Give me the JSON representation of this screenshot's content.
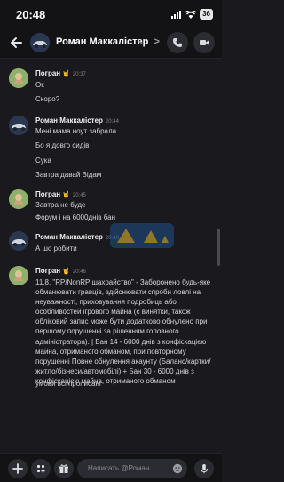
{
  "status_bar": {
    "time": "20:48",
    "battery": "36"
  },
  "header": {
    "title": "Роман Маккалістер",
    "chevron": ">"
  },
  "messages": [
    {
      "user": "Погран",
      "badge": "🤘",
      "time": "20:37",
      "lines": [
        "Ок",
        "Скоро?"
      ]
    },
    {
      "user": "Роман Маккалістер",
      "time": "20:44",
      "lines": [
        "Мені мама ноут забрала",
        "Бо я довго сидів",
        "Сука",
        "Завтра давай Відам"
      ]
    },
    {
      "user": "Погран",
      "badge": "🤘",
      "time": "20:45",
      "lines": [
        "Завтра не буде",
        "Форум і на 6000днів бан"
      ]
    },
    {
      "user": "Роман Маккалістер",
      "time": "20:46",
      "lines": [
        "А шо робити"
      ]
    },
    {
      "user": "Погран",
      "badge": "🤘",
      "time": "20:46",
      "paragraph": "11.8. \"RP/NonRP шахрайство\" - Заборонено будь-яке обманювати гравців, здійснювати спроби ловлі на неуважності, приховування подробиць або особливостей ігрового майна (є винятки, також обліковий запис може бути додатково обнулено при першому порушенні за рішенням головного адміністратора). | Бан 14 - 6000 днів з конфіскацією майна, отриманого обманом, при повторному порушенні Повне обнулення акаунту (Баланс/картки/житло/бізнеси/автомобілі) + Бан 30 - 6000 днів з конфіскацією майна, отриманого обманом",
      "lines": [
        "умови всі прописані"
      ]
    }
  ],
  "composer": {
    "placeholder": "Написать @Роман..."
  },
  "colors": {
    "background": "#1a1a1e",
    "bar": "#131316",
    "badge": "#f2b01e",
    "button": "#2b2c31"
  },
  "icons": [
    "back-arrow-icon",
    "voice-call-icon",
    "video-call-icon",
    "plus-icon",
    "apps-icon",
    "gift-icon",
    "emoji-icon",
    "microphone-icon",
    "wifi-icon",
    "signal-icon"
  ]
}
